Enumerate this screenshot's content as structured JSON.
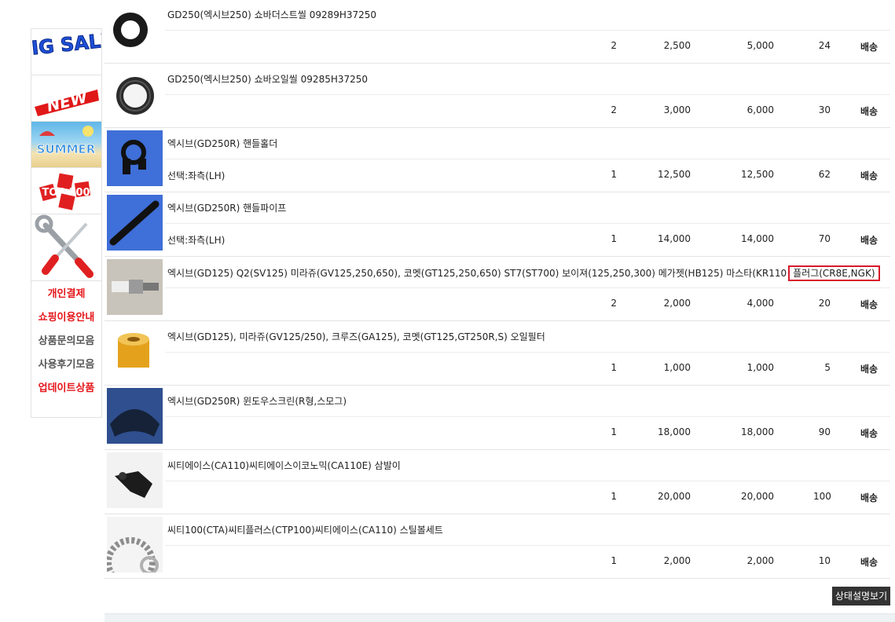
{
  "sidebar": {
    "banners": [
      {
        "text": "BIG SALE"
      },
      {
        "text": "NEW"
      },
      {
        "text": "SUMMER"
      },
      {
        "text": "TOP 100"
      },
      {
        "text": ""
      }
    ],
    "links": [
      "개인결제",
      "쇼핑이용안내",
      "상품문의모음",
      "사용후기모음",
      "업데이트상품"
    ]
  },
  "items": [
    {
      "name": "GD250(엑시브250) 쇼바더스트씰 09289H37250",
      "option": "",
      "qty": "2",
      "price": "2,500",
      "total": "5,000",
      "point": "24",
      "ship": "배송",
      "thumb": "seal-ring"
    },
    {
      "name": "GD250(엑시브250) 쇼바오일씰 09285H37250",
      "option": "",
      "qty": "2",
      "price": "3,000",
      "total": "6,000",
      "point": "30",
      "ship": "배송",
      "thumb": "oil-seal"
    },
    {
      "name": "엑시브(GD250R) 핸들홀더",
      "option": "선택:좌측(LH)",
      "qty": "1",
      "price": "12,500",
      "total": "12,500",
      "point": "62",
      "ship": "배송",
      "thumb": "handle-holder"
    },
    {
      "name": "엑시브(GD250R) 핸들파이프",
      "option": "선택:좌측(LH)",
      "qty": "1",
      "price": "14,000",
      "total": "14,000",
      "point": "70",
      "ship": "배송",
      "thumb": "handle-pipe"
    },
    {
      "name": "엑시브(GD125) Q2(SV125) 미라쥬(GV125,250,650), 코멧(GT125,250,650) ST7(ST700) 보이져(125,250,300) 메가젯(HB125) 마스타(KR110",
      "name_highlight": "플러그(CR8E,NGK)",
      "option": "",
      "qty": "2",
      "price": "2,000",
      "total": "4,000",
      "point": "20",
      "ship": "배송",
      "thumb": "spark-plug"
    },
    {
      "name": "엑시브(GD125), 미라쥬(GV125/250), 크루즈(GA125), 코멧(GT125,GT250R,S) 오일필터",
      "option": "",
      "qty": "1",
      "price": "1,000",
      "total": "1,000",
      "point": "5",
      "ship": "배송",
      "thumb": "oil-filter"
    },
    {
      "name": "엑시브(GD250R) 윈도우스크린(R형,스모그)",
      "option": "",
      "qty": "1",
      "price": "18,000",
      "total": "18,000",
      "point": "90",
      "ship": "배송",
      "thumb": "windscreen"
    },
    {
      "name": "씨티에이스(CA110)씨티에이스이코노믹(CA110E) 삼발이",
      "option": "",
      "qty": "1",
      "price": "20,000",
      "total": "20,000",
      "point": "100",
      "ship": "배송",
      "thumb": "tripod-bracket"
    },
    {
      "name": "씨티100(CTA)씨티플러스(CTP100)씨티에이스(CA110) 스틸볼세트",
      "option": "",
      "qty": "1",
      "price": "2,000",
      "total": "2,000",
      "point": "10",
      "ship": "배송",
      "thumb": "steel-ball-set"
    }
  ],
  "status_button": "상태설명보기",
  "colors": {
    "accent_red": "#e5161a",
    "highlight_border": "#d8192a"
  }
}
